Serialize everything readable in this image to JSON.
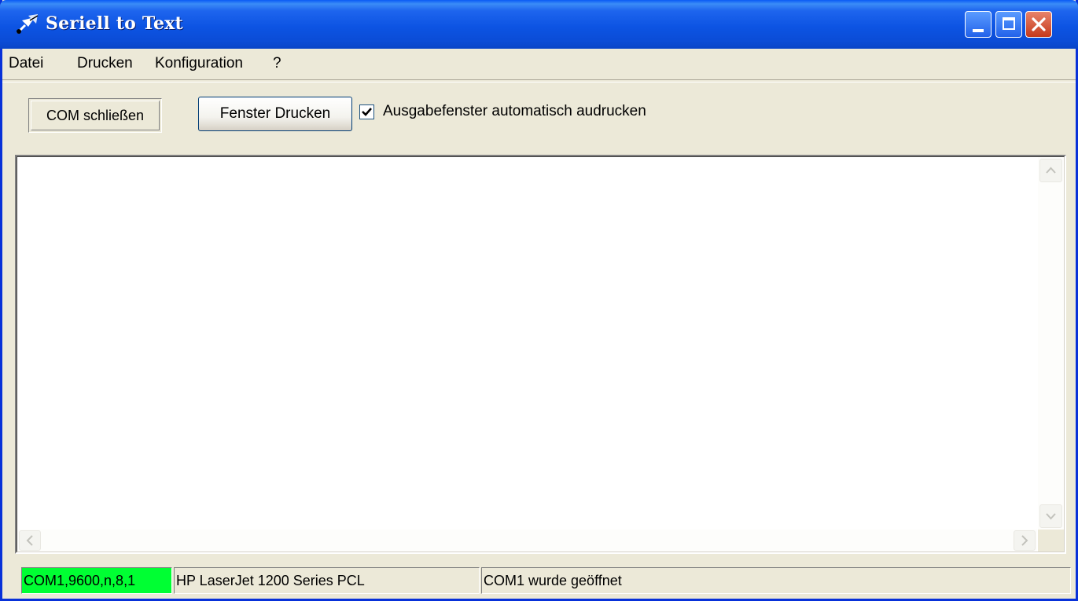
{
  "window": {
    "title": "Seriell to Text",
    "colors": {
      "titlebar": "#0b4cd6",
      "face": "#ece9d8",
      "port_status_bg": "#00ff33"
    }
  },
  "title_buttons": {
    "minimize": "minimize-icon",
    "maximize": "maximize-icon",
    "close": "close-icon"
  },
  "menu": {
    "items": [
      {
        "label": "Datei"
      },
      {
        "label": "Drucken"
      },
      {
        "label": "Konfiguration"
      },
      {
        "label": "?"
      }
    ]
  },
  "toolbar": {
    "com_button_label": "COM schließen",
    "print_button_label": "Fenster Drucken",
    "auto_print": {
      "label": "Ausgabefenster automatisch audrucken",
      "checked": true
    }
  },
  "output": {
    "text": ""
  },
  "statusbar": {
    "port": "COM1,9600,n,8,1",
    "printer": "HP LaserJet 1200 Series PCL",
    "message": "COM1 wurde geöffnet"
  }
}
